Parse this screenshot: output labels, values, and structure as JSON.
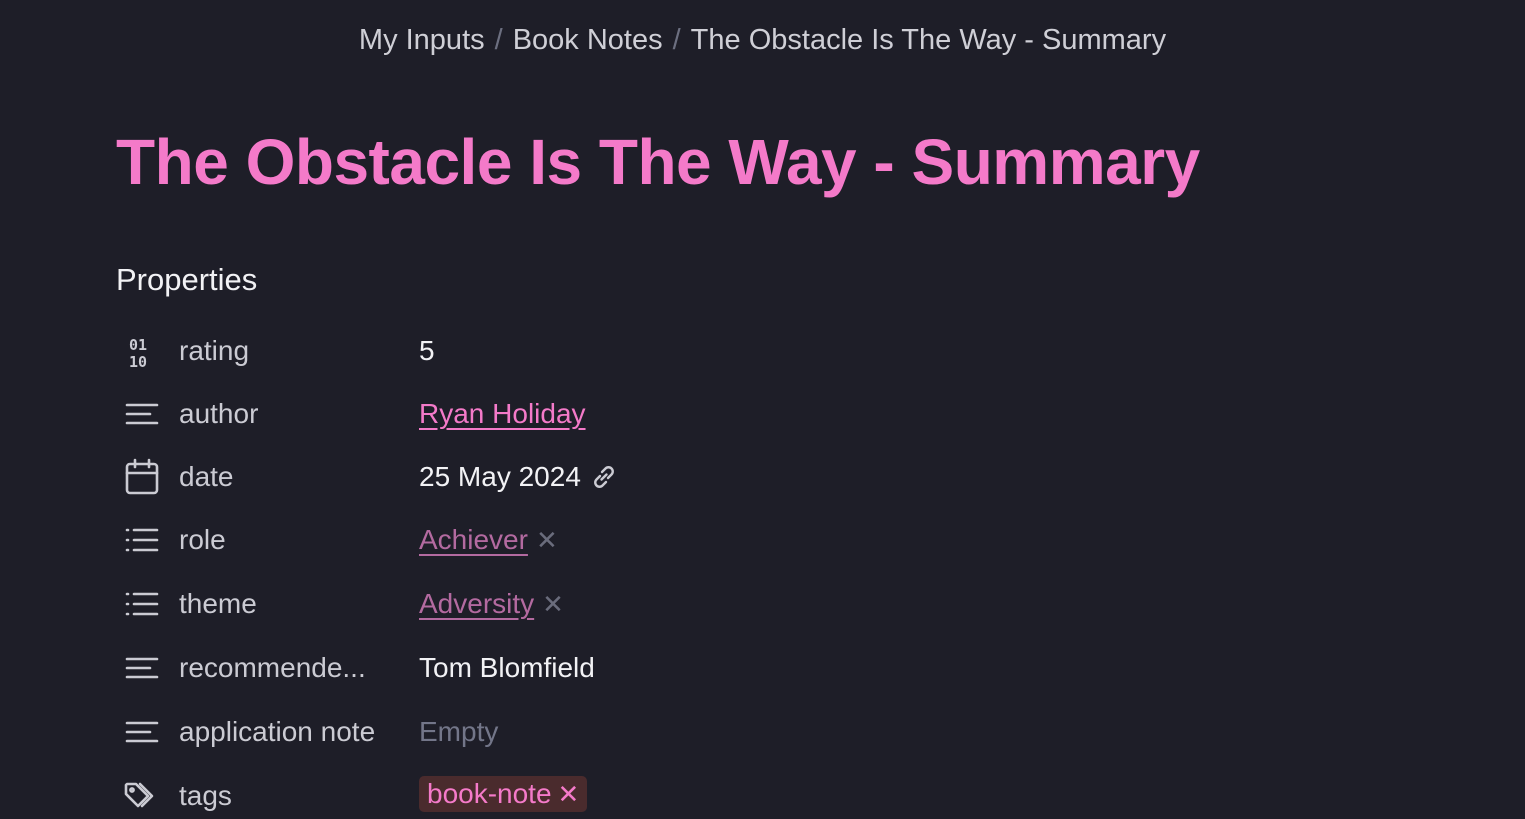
{
  "breadcrumb": {
    "items": [
      "My Inputs",
      "Book Notes",
      "The Obstacle Is The Way - Summary"
    ],
    "separator": "/"
  },
  "title": "The Obstacle Is The Way - Summary",
  "properties": {
    "heading": "Properties",
    "rating": {
      "name": "rating",
      "value": "5",
      "icon": "number-icon"
    },
    "author": {
      "name": "author",
      "value": "Ryan Holiday",
      "icon": "text-lines-icon"
    },
    "date": {
      "name": "date",
      "value": "25 May 2024",
      "icon": "calendar-icon"
    },
    "role": {
      "name": "role",
      "value": "Achiever",
      "remove": "✕",
      "icon": "list-icon"
    },
    "theme": {
      "name": "theme",
      "value": "Adversity",
      "remove": "✕",
      "icon": "list-icon"
    },
    "recommended": {
      "name": "recommende...",
      "value": "Tom Blomfield",
      "icon": "text-lines-icon"
    },
    "application_note": {
      "name": "application note",
      "value": "Empty",
      "icon": "text-lines-icon"
    },
    "tags": {
      "name": "tags",
      "value": "book-note",
      "remove": "✕",
      "icon": "tags-icon"
    }
  },
  "colors": {
    "background": "#1e1e28",
    "accent": "#f47ac9",
    "text": "#f2f2f5",
    "muted": "#737689"
  }
}
